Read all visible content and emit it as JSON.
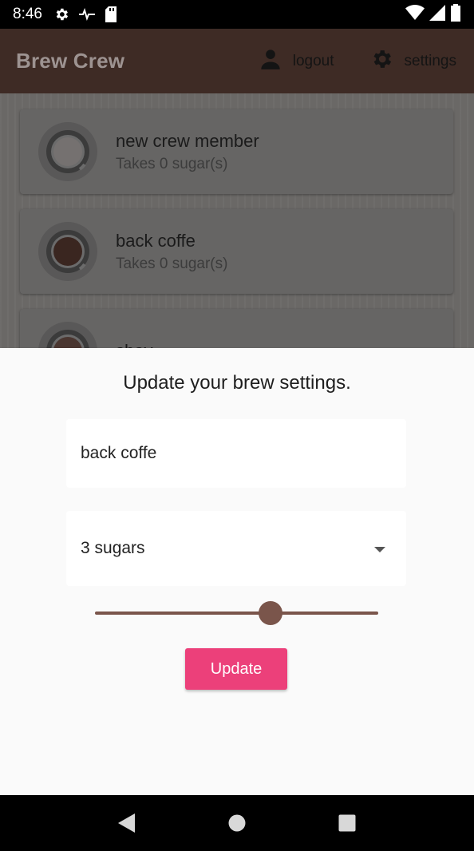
{
  "status_bar": {
    "time": "8:46",
    "icons": [
      "gear-icon",
      "pulse-icon",
      "sd-card-icon",
      "wifi-icon",
      "signal-icon",
      "battery-icon"
    ]
  },
  "app_bar": {
    "title": "Brew Crew",
    "logout_label": "logout",
    "settings_label": "settings",
    "colors": {
      "background": "#3e2b25",
      "title": "#9d9391"
    }
  },
  "crew_list": [
    {
      "name": "new crew member",
      "subtitle": "Takes 0 sugar(s)"
    },
    {
      "name": "back coffe",
      "subtitle": "Takes 0 sugar(s)"
    },
    {
      "name": "shay",
      "subtitle": ""
    }
  ],
  "sheet": {
    "title": "Update your brew settings.",
    "name_value": "back coffe",
    "sugar_selected": "3 sugars",
    "strength_fraction": 0.62,
    "update_label": "Update",
    "colors": {
      "accent": "#ec407a",
      "slider": "#7a554b"
    }
  },
  "nav_bar": {
    "icons": [
      "back-icon",
      "home-icon",
      "recents-icon"
    ]
  }
}
